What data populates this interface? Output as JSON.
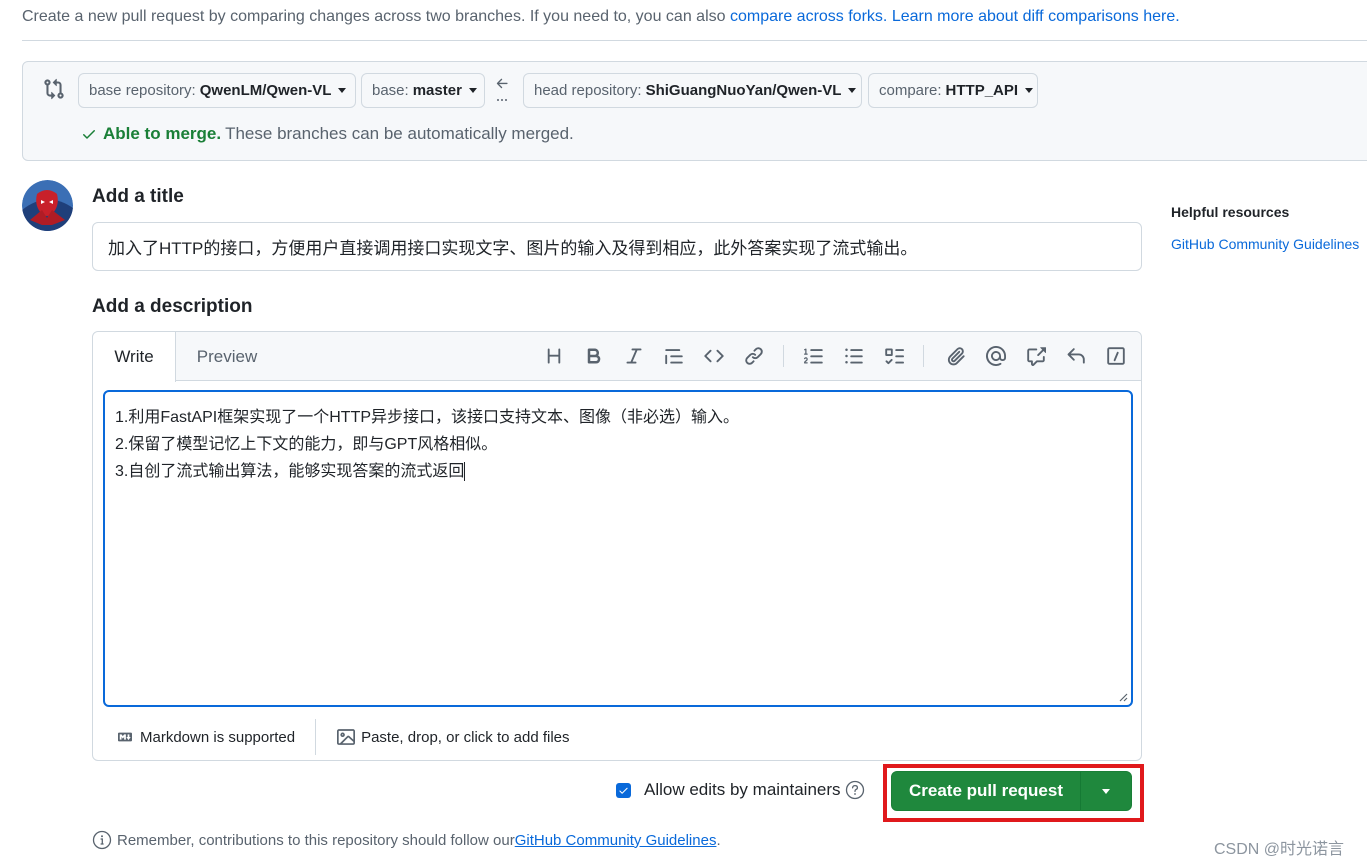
{
  "intro": {
    "text": "Create a new pull request by comparing changes across two branches. If you need to, you can also ",
    "link1": "compare across forks.",
    "link2": "Learn more about diff comparisons here."
  },
  "compare": {
    "base_repo_label": "base repository:",
    "base_repo_value": "QwenLM/Qwen-VL",
    "base_label": "base:",
    "base_value": "master",
    "head_repo_label": "head repository:",
    "head_repo_value": "ShiGuangNuoYan/Qwen-VL",
    "compare_label": "compare:",
    "compare_value": "HTTP_API",
    "merge_ok": "Able to merge.",
    "merge_text": "These branches can be automatically merged."
  },
  "title_section": {
    "label": "Add a title",
    "value": "加入了HTTP的接口，方便用户直接调用接口实现文字、图片的输入及得到相应，此外答案实现了流式输出。"
  },
  "description": {
    "label": "Add a description",
    "tab_write": "Write",
    "tab_preview": "Preview",
    "lines": [
      "1.利用FastAPI框架实现了一个HTTP异步接口，该接口支持文本、图像（非必选）输入。",
      "2.保留了模型记忆上下文的能力，即与GPT风格相似。",
      "3.自创了流式输出算法，能够实现答案的流式返回"
    ],
    "markdown_note": "Markdown is supported",
    "attach_note": "Paste, drop, or click to add files"
  },
  "actions": {
    "allow_edits": "Allow edits by maintainers",
    "allow_edits_checked": true,
    "create_label": "Create pull request"
  },
  "remember": {
    "text": "Remember, contributions to this repository should follow our ",
    "link": "GitHub Community Guidelines",
    "suffix": "."
  },
  "sidebar": {
    "heading": "Helpful resources",
    "link": "GitHub Community Guidelines"
  },
  "watermark": "CSDN @时光诺言",
  "colors": {
    "accent": "#0969da",
    "success": "#1a7f37",
    "primary_button": "#1f883d",
    "highlight": "#e0191c"
  }
}
